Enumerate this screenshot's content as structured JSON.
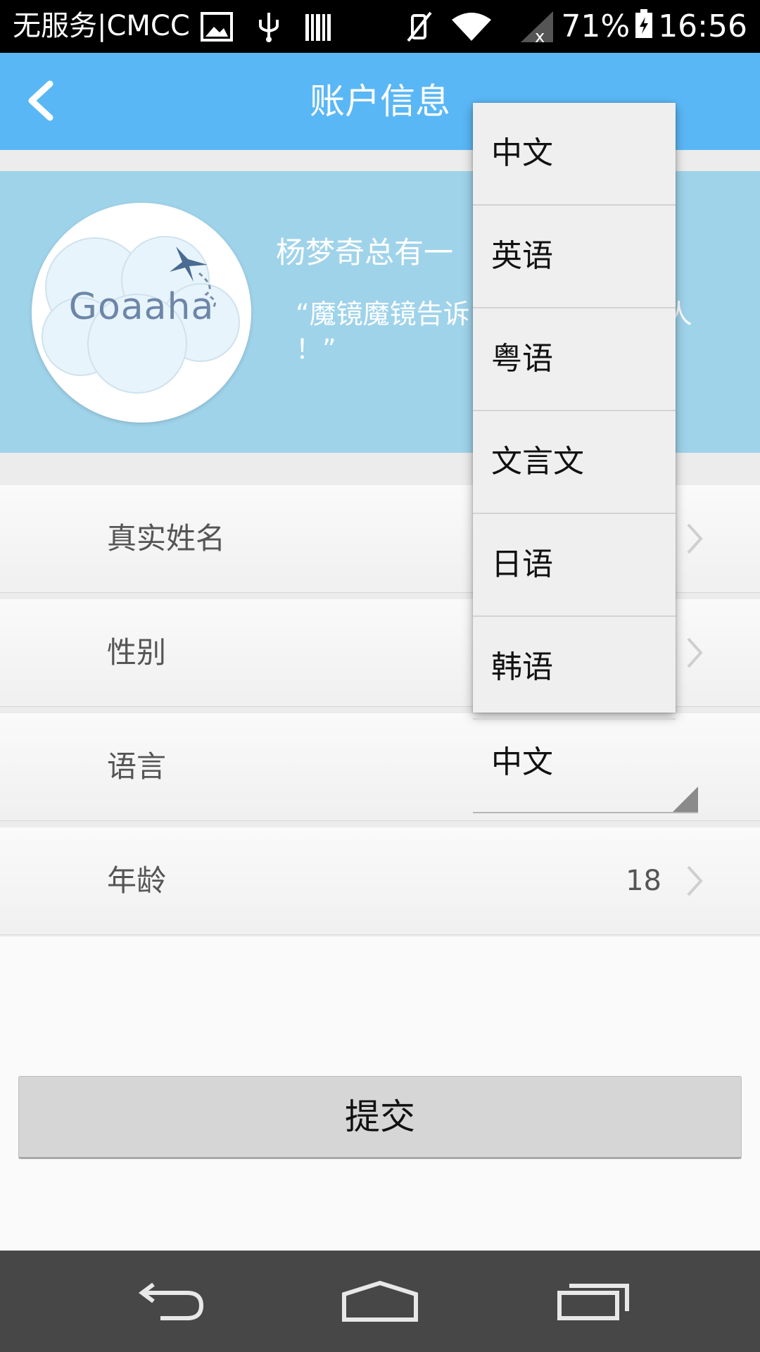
{
  "status_bar": {
    "carrier": "无服务|CMCC",
    "battery": "71%",
    "time": "16:56"
  },
  "app_bar": {
    "title": "账户信息"
  },
  "profile": {
    "avatar_text": "Goaaha",
    "username": "杨梦奇总有一",
    "motto": "“魔镜魔镜告诉  世界上最美丽的人  ！”"
  },
  "rows": [
    {
      "label": "真实姓名",
      "value": ""
    },
    {
      "label": "性别",
      "value": ""
    },
    {
      "label": "语言",
      "value": "中文"
    },
    {
      "label": "年龄",
      "value": "18"
    }
  ],
  "language_options": [
    "中文",
    "英语",
    "粤语",
    "文言文",
    "日语",
    "韩语"
  ],
  "submit_label": "提交",
  "colors": {
    "app_bar": "#5ab7f5",
    "banner": "#9fd3ea",
    "nav_bar": "#474747"
  }
}
